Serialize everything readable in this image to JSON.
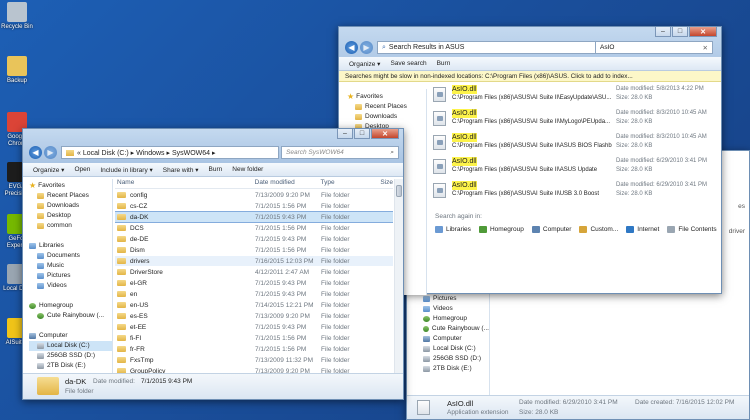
{
  "desktop": {
    "icons": [
      {
        "label": "Recycle Bin",
        "color": "#b9c4cf"
      },
      {
        "label": "Backup",
        "color": "#e9c45a"
      },
      {
        "label": "Google Chrom",
        "color": "#db4437"
      },
      {
        "label": "EVGA Precision",
        "color": "#1d1d1d"
      },
      {
        "label": "GeFor Experie",
        "color": "#76b900"
      },
      {
        "label": "Local Disk",
        "color": "#9aa6b2"
      },
      {
        "label": "AISuiteII",
        "color": "#f0c419"
      }
    ]
  },
  "search_window": {
    "address": "Search Results in ASUS",
    "search_value": "AsIO",
    "toolbar": [
      "Organize ▾",
      "Save search",
      "Burn"
    ],
    "info_bar": "Searches might be slow in non-indexed locations: C:\\Program Files (x86)\\ASUS. Click to add to index...",
    "nav": [
      {
        "label": "Favorites",
        "icon": "star",
        "indent": 0
      },
      {
        "label": "Recent Places",
        "icon": "fold",
        "indent": 1
      },
      {
        "label": "Downloads",
        "icon": "fold",
        "indent": 1
      },
      {
        "label": "Desktop",
        "icon": "fold",
        "indent": 1
      }
    ],
    "results": [
      {
        "name": "AsIO.dll",
        "path": "C:\\Program Files (x86)\\ASUS\\AI Suite II\\EasyUpdate\\ASU...",
        "date": "Date modified: 5/8/2013 4:22 PM",
        "size": "Size: 28.0 KB"
      },
      {
        "name": "AsIO.dll",
        "path": "C:\\Program Files (x86)\\ASUS\\AI Suite II\\MyLogo\\PEUpda...",
        "date": "Date modified: 8/3/2010 10:45 AM",
        "size": "Size: 28.0 KB"
      },
      {
        "name": "AsIO.dll",
        "path": "C:\\Program Files (x86)\\ASUS\\AI Suite II\\ASUS BIOS Flashba...",
        "date": "Date modified: 8/3/2010 10:45 AM",
        "size": "Size: 28.0 KB"
      },
      {
        "name": "AsIO.dll",
        "path": "C:\\Program Files (x86)\\ASUS\\AI Suite II\\ASUS Update",
        "date": "Date modified: 6/29/2010 3:41 PM",
        "size": "Size: 28.0 KB"
      },
      {
        "name": "AsIO.dll",
        "path": "C:\\Program Files (x86)\\ASUS\\AI Suite II\\USB 3.0 Boost",
        "date": "Date modified: 6/29/2010 3:41 PM",
        "size": "Size: 28.0 KB"
      }
    ],
    "search_again": "Search again in:",
    "search_again_items": [
      {
        "label": "Libraries",
        "color": "#6b9ad3"
      },
      {
        "label": "Homegroup",
        "color": "#4f9a38"
      },
      {
        "label": "Computer",
        "color": "#5d83b0"
      },
      {
        "label": "Custom...",
        "color": "#d6a53a"
      },
      {
        "label": "Internet",
        "color": "#2f78c4"
      },
      {
        "label": "File Contents",
        "color": "#9aa6b2"
      }
    ]
  },
  "back_window": {
    "nav": [
      {
        "label": "Pictures",
        "icon": "lib"
      },
      {
        "label": "Videos",
        "icon": "lib"
      },
      {
        "label": "Homegroup",
        "icon": "grp"
      },
      {
        "label": "Cute Rainybouw (...",
        "icon": "grp"
      },
      {
        "label": "Computer",
        "icon": "cmp"
      },
      {
        "label": "Local Disk (C:)",
        "icon": "drv"
      },
      {
        "label": "256GB SSD (D:)",
        "icon": "drv"
      },
      {
        "label": "2TB Disk (E:)",
        "icon": "drv"
      }
    ],
    "right_snips": [
      "es",
      "driver"
    ],
    "status_name": "AsIO.dll",
    "status_type": "Application extension",
    "status_date": "Date modified: 6/29/2010 3:41 PM",
    "status_size": "Size: 28.0 KB",
    "status_created": "Date created: 7/16/2015 12:02 PM"
  },
  "syswow_window": {
    "breadcrumb": "« Local Disk (C:) ▸ Windows ▸ SysWOW64 ▸",
    "search_placeholder": "Search SysWOW64",
    "toolbar": [
      "Organize ▾",
      "Open",
      "Include in library ▾",
      "Share with ▾",
      "Burn",
      "New folder"
    ],
    "columns": [
      "Name",
      "Date modified",
      "Type",
      "Size"
    ],
    "nav": [
      {
        "label": "Favorites",
        "icon": "star",
        "indent": 0
      },
      {
        "label": "Recent Places",
        "icon": "fold",
        "indent": 1
      },
      {
        "label": "Downloads",
        "icon": "fold",
        "indent": 1
      },
      {
        "label": "Desktop",
        "icon": "fold",
        "indent": 1
      },
      {
        "label": "common",
        "icon": "fold",
        "indent": 1
      },
      {
        "label": "",
        "icon": "",
        "indent": 0
      },
      {
        "label": "Libraries",
        "icon": "lib",
        "indent": 0
      },
      {
        "label": "Documents",
        "icon": "lib",
        "indent": 1
      },
      {
        "label": "Music",
        "icon": "lib",
        "indent": 1
      },
      {
        "label": "Pictures",
        "icon": "lib",
        "indent": 1
      },
      {
        "label": "Videos",
        "icon": "lib",
        "indent": 1
      },
      {
        "label": "",
        "icon": "",
        "indent": 0
      },
      {
        "label": "Homegroup",
        "icon": "grp",
        "indent": 0
      },
      {
        "label": "Cute Rainybouw (...",
        "icon": "grp",
        "indent": 1
      },
      {
        "label": "",
        "icon": "",
        "indent": 0
      },
      {
        "label": "Computer",
        "icon": "cmp",
        "indent": 0
      },
      {
        "label": "Local Disk (C:)",
        "icon": "drv",
        "indent": 1,
        "selected": true
      },
      {
        "label": "256GB SSD (D:)",
        "icon": "drv",
        "indent": 1
      },
      {
        "label": "2TB Disk (E:)",
        "icon": "drv",
        "indent": 1
      }
    ],
    "files": [
      {
        "name": "config",
        "date": "7/13/2009 9:20 PM",
        "type": "File folder"
      },
      {
        "name": "cs-CZ",
        "date": "7/1/2015 1:56 PM",
        "type": "File folder"
      },
      {
        "name": "da-DK",
        "date": "7/1/2015 9:43 PM",
        "type": "File folder",
        "selected": true
      },
      {
        "name": "DCS",
        "date": "7/1/2015 1:56 PM",
        "type": "File folder"
      },
      {
        "name": "de-DE",
        "date": "7/1/2015 9:43 PM",
        "type": "File folder"
      },
      {
        "name": "Dism",
        "date": "7/1/2015 1:56 PM",
        "type": "File folder"
      },
      {
        "name": "drivers",
        "date": "7/16/2015 12:03 PM",
        "type": "File folder",
        "hover": true
      },
      {
        "name": "DriverStore",
        "date": "4/12/2011 2:47 AM",
        "type": "File folder"
      },
      {
        "name": "el-GR",
        "date": "7/1/2015 9:43 PM",
        "type": "File folder"
      },
      {
        "name": "en",
        "date": "7/1/2015 9:43 PM",
        "type": "File folder"
      },
      {
        "name": "en-US",
        "date": "7/14/2015 12:21 PM",
        "type": "File folder"
      },
      {
        "name": "es-ES",
        "date": "7/13/2009 9:20 PM",
        "type": "File folder"
      },
      {
        "name": "et-EE",
        "date": "7/1/2015 9:43 PM",
        "type": "File folder"
      },
      {
        "name": "fi-FI",
        "date": "7/1/2015 1:56 PM",
        "type": "File folder"
      },
      {
        "name": "fr-FR",
        "date": "7/1/2015 1:56 PM",
        "type": "File folder"
      },
      {
        "name": "FxsTmp",
        "date": "7/13/2009 11:32 PM",
        "type": "File folder"
      },
      {
        "name": "GroupPolicy",
        "date": "7/13/2009 9:20 PM",
        "type": "File folder"
      }
    ],
    "status_name": "da-DK",
    "status_date_label": "Date modified:",
    "status_date": "7/1/2015 9:43 PM",
    "status_type": "File folder"
  }
}
